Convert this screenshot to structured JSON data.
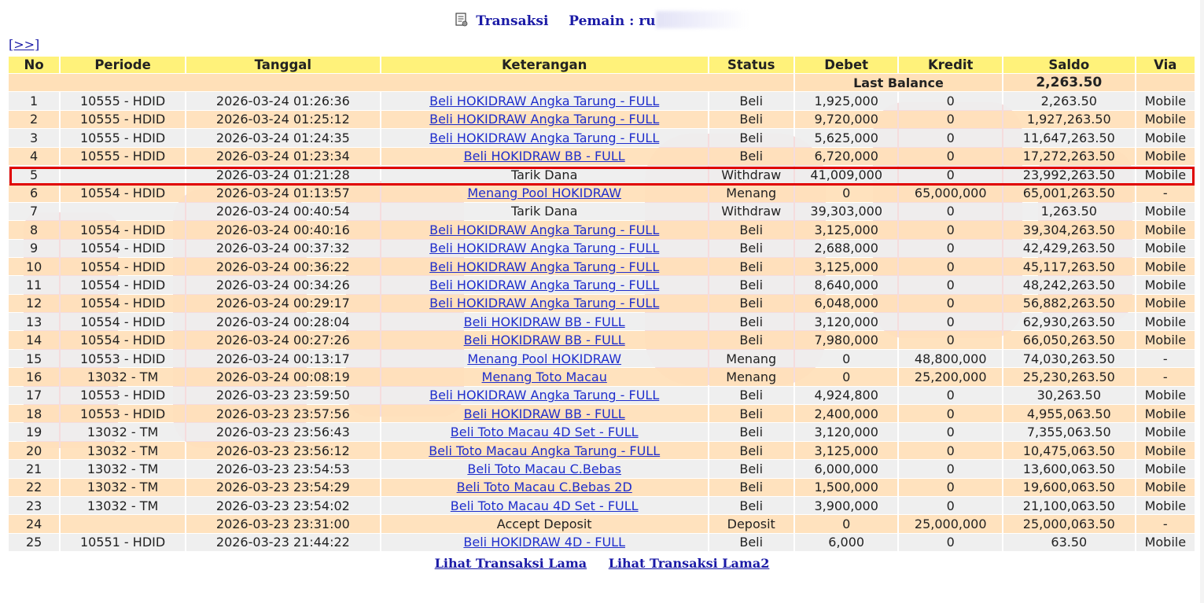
{
  "header": {
    "title_label": "Transaksi",
    "player_label": "Pemain : ru"
  },
  "nav": {
    "next_label": "[>>]"
  },
  "table": {
    "columns": [
      "No",
      "Periode",
      "Tanggal",
      "Keterangan",
      "Status",
      "Debet",
      "Kredit",
      "Saldo",
      "Via"
    ],
    "last_balance_label": "Last Balance",
    "last_balance_value": "2,263.50",
    "rows": [
      {
        "no": "1",
        "periode": "10555 - HDID",
        "tanggal": "2026-03-24 01:26:36",
        "keterangan": "Beli HOKIDRAW Angka Tarung - FULL",
        "link": true,
        "status": "Beli",
        "debet": "1,925,000",
        "kredit": "0",
        "saldo": "2,263.50",
        "via": "Mobile"
      },
      {
        "no": "2",
        "periode": "10555 - HDID",
        "tanggal": "2026-03-24 01:25:12",
        "keterangan": "Beli HOKIDRAW Angka Tarung - FULL",
        "link": true,
        "status": "Beli",
        "debet": "9,720,000",
        "kredit": "0",
        "saldo": "1,927,263.50",
        "via": "Mobile"
      },
      {
        "no": "3",
        "periode": "10555 - HDID",
        "tanggal": "2026-03-24 01:24:35",
        "keterangan": "Beli HOKIDRAW Angka Tarung - FULL",
        "link": true,
        "status": "Beli",
        "debet": "5,625,000",
        "kredit": "0",
        "saldo": "11,647,263.50",
        "via": "Mobile"
      },
      {
        "no": "4",
        "periode": "10555 - HDID",
        "tanggal": "2026-03-24 01:23:34",
        "keterangan": "Beli HOKIDRAW BB - FULL",
        "link": true,
        "status": "Beli",
        "debet": "6,720,000",
        "kredit": "0",
        "saldo": "17,272,263.50",
        "via": "Mobile"
      },
      {
        "no": "5",
        "periode": "",
        "tanggal": "2026-03-24 01:21:28",
        "keterangan": "Tarik Dana",
        "link": false,
        "status": "Withdraw",
        "debet": "41,009,000",
        "kredit": "0",
        "saldo": "23,992,263.50",
        "via": "Mobile"
      },
      {
        "no": "6",
        "periode": "10554 - HDID",
        "tanggal": "2026-03-24 01:13:57",
        "keterangan": "Menang Pool HOKIDRAW",
        "link": true,
        "status": "Menang",
        "debet": "0",
        "kredit": "65,000,000",
        "saldo": "65,001,263.50",
        "via": "-"
      },
      {
        "no": "7",
        "periode": "",
        "tanggal": "2026-03-24 00:40:54",
        "keterangan": "Tarik Dana",
        "link": false,
        "status": "Withdraw",
        "debet": "39,303,000",
        "kredit": "0",
        "saldo": "1,263.50",
        "via": "Mobile"
      },
      {
        "no": "8",
        "periode": "10554 - HDID",
        "tanggal": "2026-03-24 00:40:16",
        "keterangan": "Beli HOKIDRAW Angka Tarung - FULL",
        "link": true,
        "status": "Beli",
        "debet": "3,125,000",
        "kredit": "0",
        "saldo": "39,304,263.50",
        "via": "Mobile"
      },
      {
        "no": "9",
        "periode": "10554 - HDID",
        "tanggal": "2026-03-24 00:37:32",
        "keterangan": "Beli HOKIDRAW Angka Tarung - FULL",
        "link": true,
        "status": "Beli",
        "debet": "2,688,000",
        "kredit": "0",
        "saldo": "42,429,263.50",
        "via": "Mobile"
      },
      {
        "no": "10",
        "periode": "10554 - HDID",
        "tanggal": "2026-03-24 00:36:22",
        "keterangan": "Beli HOKIDRAW Angka Tarung - FULL",
        "link": true,
        "status": "Beli",
        "debet": "3,125,000",
        "kredit": "0",
        "saldo": "45,117,263.50",
        "via": "Mobile"
      },
      {
        "no": "11",
        "periode": "10554 - HDID",
        "tanggal": "2026-03-24 00:34:26",
        "keterangan": "Beli HOKIDRAW Angka Tarung - FULL",
        "link": true,
        "status": "Beli",
        "debet": "8,640,000",
        "kredit": "0",
        "saldo": "48,242,263.50",
        "via": "Mobile"
      },
      {
        "no": "12",
        "periode": "10554 - HDID",
        "tanggal": "2026-03-24 00:29:17",
        "keterangan": "Beli HOKIDRAW Angka Tarung - FULL",
        "link": true,
        "status": "Beli",
        "debet": "6,048,000",
        "kredit": "0",
        "saldo": "56,882,263.50",
        "via": "Mobile"
      },
      {
        "no": "13",
        "periode": "10554 - HDID",
        "tanggal": "2026-03-24 00:28:04",
        "keterangan": "Beli HOKIDRAW BB - FULL",
        "link": true,
        "status": "Beli",
        "debet": "3,120,000",
        "kredit": "0",
        "saldo": "62,930,263.50",
        "via": "Mobile"
      },
      {
        "no": "14",
        "periode": "10554 - HDID",
        "tanggal": "2026-03-24 00:27:26",
        "keterangan": "Beli HOKIDRAW BB - FULL",
        "link": true,
        "status": "Beli",
        "debet": "7,980,000",
        "kredit": "0",
        "saldo": "66,050,263.50",
        "via": "Mobile"
      },
      {
        "no": "15",
        "periode": "10553 - HDID",
        "tanggal": "2026-03-24 00:13:17",
        "keterangan": "Menang Pool HOKIDRAW",
        "link": true,
        "status": "Menang",
        "debet": "0",
        "kredit": "48,800,000",
        "saldo": "74,030,263.50",
        "via": "-"
      },
      {
        "no": "16",
        "periode": "13032 - TM",
        "tanggal": "2026-03-24 00:08:19",
        "keterangan": "Menang Toto Macau",
        "link": true,
        "status": "Menang",
        "debet": "0",
        "kredit": "25,200,000",
        "saldo": "25,230,263.50",
        "via": "-"
      },
      {
        "no": "17",
        "periode": "10553 - HDID",
        "tanggal": "2026-03-23 23:59:50",
        "keterangan": "Beli HOKIDRAW Angka Tarung - FULL",
        "link": true,
        "status": "Beli",
        "debet": "4,924,800",
        "kredit": "0",
        "saldo": "30,263.50",
        "via": "Mobile"
      },
      {
        "no": "18",
        "periode": "10553 - HDID",
        "tanggal": "2026-03-23 23:57:56",
        "keterangan": "Beli HOKIDRAW BB - FULL",
        "link": true,
        "status": "Beli",
        "debet": "2,400,000",
        "kredit": "0",
        "saldo": "4,955,063.50",
        "via": "Mobile"
      },
      {
        "no": "19",
        "periode": "13032 - TM",
        "tanggal": "2026-03-23 23:56:43",
        "keterangan": "Beli Toto Macau 4D Set - FULL",
        "link": true,
        "status": "Beli",
        "debet": "3,120,000",
        "kredit": "0",
        "saldo": "7,355,063.50",
        "via": "Mobile"
      },
      {
        "no": "20",
        "periode": "13032 - TM",
        "tanggal": "2026-03-23 23:56:12",
        "keterangan": "Beli Toto Macau Angka Tarung - FULL",
        "link": true,
        "status": "Beli",
        "debet": "3,125,000",
        "kredit": "0",
        "saldo": "10,475,063.50",
        "via": "Mobile"
      },
      {
        "no": "21",
        "periode": "13032 - TM",
        "tanggal": "2026-03-23 23:54:53",
        "keterangan": "Beli Toto Macau C.Bebas",
        "link": true,
        "status": "Beli",
        "debet": "6,000,000",
        "kredit": "0",
        "saldo": "13,600,063.50",
        "via": "Mobile"
      },
      {
        "no": "22",
        "periode": "13032 - TM",
        "tanggal": "2026-03-23 23:54:29",
        "keterangan": "Beli Toto Macau C.Bebas 2D",
        "link": true,
        "status": "Beli",
        "debet": "1,500,000",
        "kredit": "0",
        "saldo": "19,600,063.50",
        "via": "Mobile"
      },
      {
        "no": "23",
        "periode": "13032 - TM",
        "tanggal": "2026-03-23 23:54:02",
        "keterangan": "Beli Toto Macau 4D Set - FULL",
        "link": true,
        "status": "Beli",
        "debet": "3,900,000",
        "kredit": "0",
        "saldo": "21,100,063.50",
        "via": "Mobile"
      },
      {
        "no": "24",
        "periode": "",
        "tanggal": "2026-03-23 23:31:00",
        "keterangan": "Accept Deposit",
        "link": false,
        "status": "Deposit",
        "debet": "0",
        "kredit": "25,000,000",
        "saldo": "25,000,063.50",
        "via": "-"
      },
      {
        "no": "25",
        "periode": "10551 - HDID",
        "tanggal": "2026-03-23 21:44:22",
        "keterangan": "Beli HOKIDRAW 4D - FULL",
        "link": true,
        "status": "Beli",
        "debet": "6,000",
        "kredit": "0",
        "saldo": "63.50",
        "via": "Mobile"
      }
    ]
  },
  "footer": {
    "links": [
      "Lihat Transaksi Lama",
      "Lihat Transaksi Lama2"
    ]
  },
  "colors": {
    "header_bg": "#fff27a",
    "row_odd": "#eeeeee",
    "row_even": "#ffe0b8",
    "link_blue": "#1f2ecc",
    "status_red": "#d00000",
    "highlight_red": "#e00000"
  },
  "icons": {
    "title_icon": "document-icon"
  }
}
